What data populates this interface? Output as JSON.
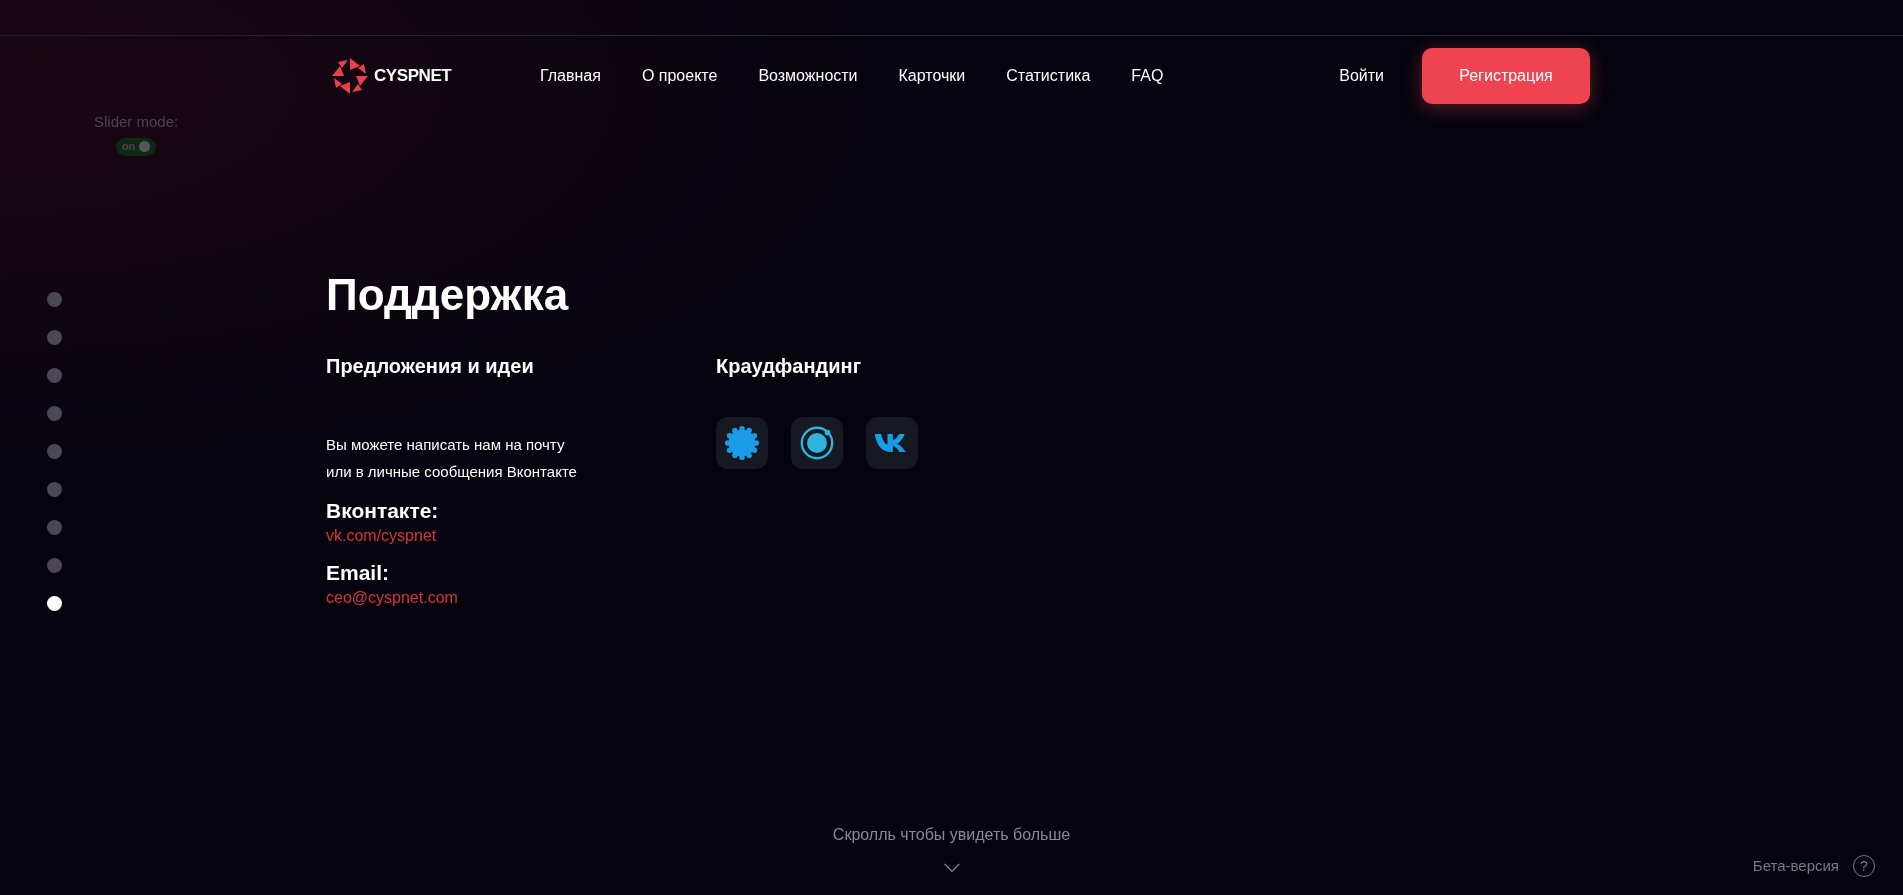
{
  "header": {
    "logo": "CYSPNET",
    "nav": [
      {
        "label": "Главная"
      },
      {
        "label": "О проекте"
      },
      {
        "label": "Возможности"
      },
      {
        "label": "Карточки"
      },
      {
        "label": "Статистика"
      },
      {
        "label": "FAQ"
      }
    ],
    "login": "Войти",
    "register": "Регистрация"
  },
  "slider_mode": {
    "label": "Slider mode:",
    "toggle_text": "on",
    "on": true
  },
  "page_dots": [
    {
      "selected": false
    },
    {
      "selected": false
    },
    {
      "selected": false
    },
    {
      "selected": false
    },
    {
      "selected": false
    },
    {
      "selected": false
    },
    {
      "selected": false
    },
    {
      "selected": false
    },
    {
      "selected": true
    }
  ],
  "support": {
    "title": "Поддержка",
    "ideas": {
      "heading": "Предложения и идеи",
      "text": "Вы можете написать нам на почту\nили в личные сообщения Вконтакте",
      "contacts": [
        {
          "label": "Вконтакте:",
          "value": "vk.com/cyspnet"
        },
        {
          "label": "Email:",
          "value": "ceo@cyspnet.com"
        }
      ]
    },
    "crowdfunding": {
      "heading": "Краудфандинг",
      "links": [
        {
          "kind": "gear"
        },
        {
          "kind": "ring"
        },
        {
          "kind": "vk"
        }
      ]
    }
  },
  "scroll_hint": "Скролль чтобы увидеть больше",
  "beta": {
    "label": "Бета-версия",
    "help": "?"
  }
}
